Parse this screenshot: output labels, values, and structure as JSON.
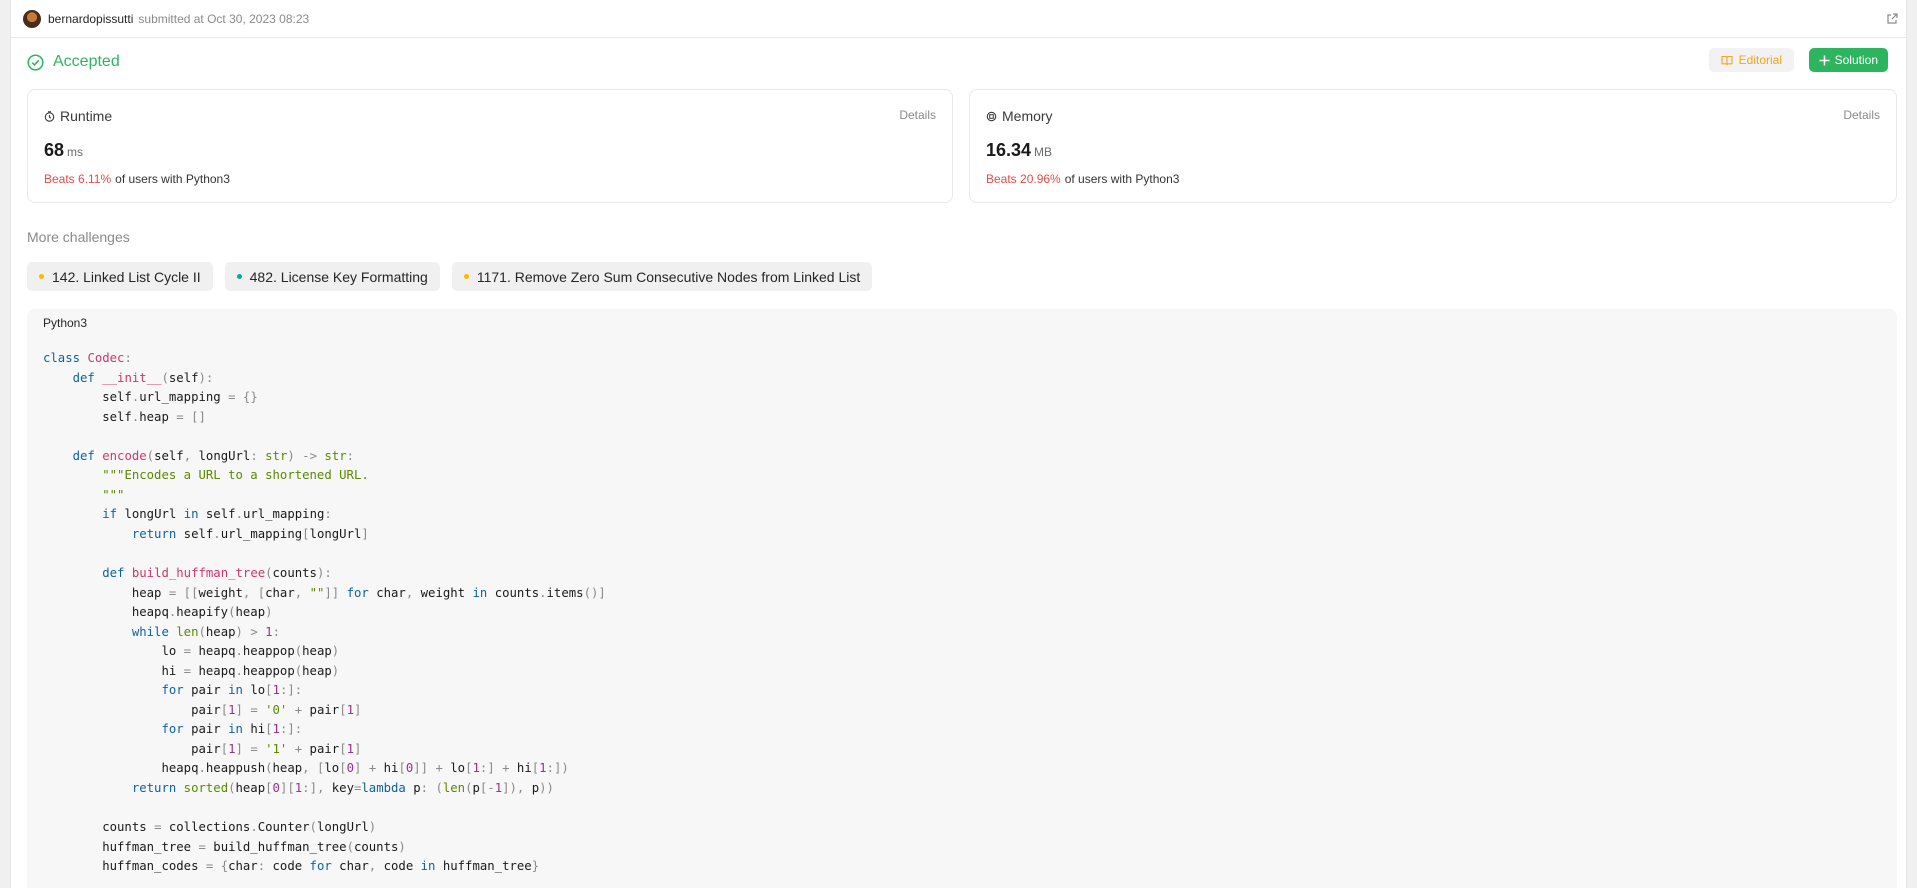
{
  "header": {
    "username": "bernardopissutti",
    "submitted_text": "submitted at Oct 30, 2023 08:23"
  },
  "status": {
    "label": "Accepted",
    "color": "#2db55d",
    "editorial_label": "Editorial",
    "solution_label": "Solution"
  },
  "runtime": {
    "title": "Runtime",
    "details_label": "Details",
    "value": "68",
    "unit": "ms",
    "beats": "Beats 6.11%",
    "suffix": "of users with Python3"
  },
  "memory": {
    "title": "Memory",
    "details_label": "Details",
    "value": "16.34",
    "unit": "MB",
    "beats": "Beats 20.96%",
    "suffix": "of users with Python3"
  },
  "more_challenges": {
    "title": "More challenges",
    "items": [
      {
        "label": "142. Linked List Cycle II",
        "difficulty_color": "#ffb800"
      },
      {
        "label": "482. License Key Formatting",
        "difficulty_color": "#00af9b"
      },
      {
        "label": "1171. Remove Zero Sum Consecutive Nodes from Linked List",
        "difficulty_color": "#ffb800"
      }
    ]
  },
  "code": {
    "language": "Python3",
    "lines": [
      "class Codec:",
      "    def __init__(self):",
      "        self.url_mapping = {}",
      "        self.heap = []",
      "",
      "    def encode(self, longUrl: str) -> str:",
      "        \"\"\"Encodes a URL to a shortened URL.",
      "        \"\"\"",
      "        if longUrl in self.url_mapping:",
      "            return self.url_mapping[longUrl]",
      "",
      "        def build_huffman_tree(counts):",
      "            heap = [[weight, [char, \"\"]] for char, weight in counts.items()]",
      "            heapq.heapify(heap)",
      "            while len(heap) > 1:",
      "                lo = heapq.heappop(heap)",
      "                hi = heapq.heappop(heap)",
      "                for pair in lo[1:]:",
      "                    pair[1] = '0' + pair[1]",
      "                for pair in hi[1:]:",
      "                    pair[1] = '1' + pair[1]",
      "                heapq.heappush(heap, [lo[0] + hi[0]] + lo[1:] + hi[1:])",
      "            return sorted(heap[0][1:], key=lambda p: (len(p[-1]), p))",
      "",
      "        counts = collections.Counter(longUrl)",
      "        huffman_tree = build_huffman_tree(counts)",
      "        huffman_codes = {char: code for char, code in huffman_tree}"
    ]
  }
}
